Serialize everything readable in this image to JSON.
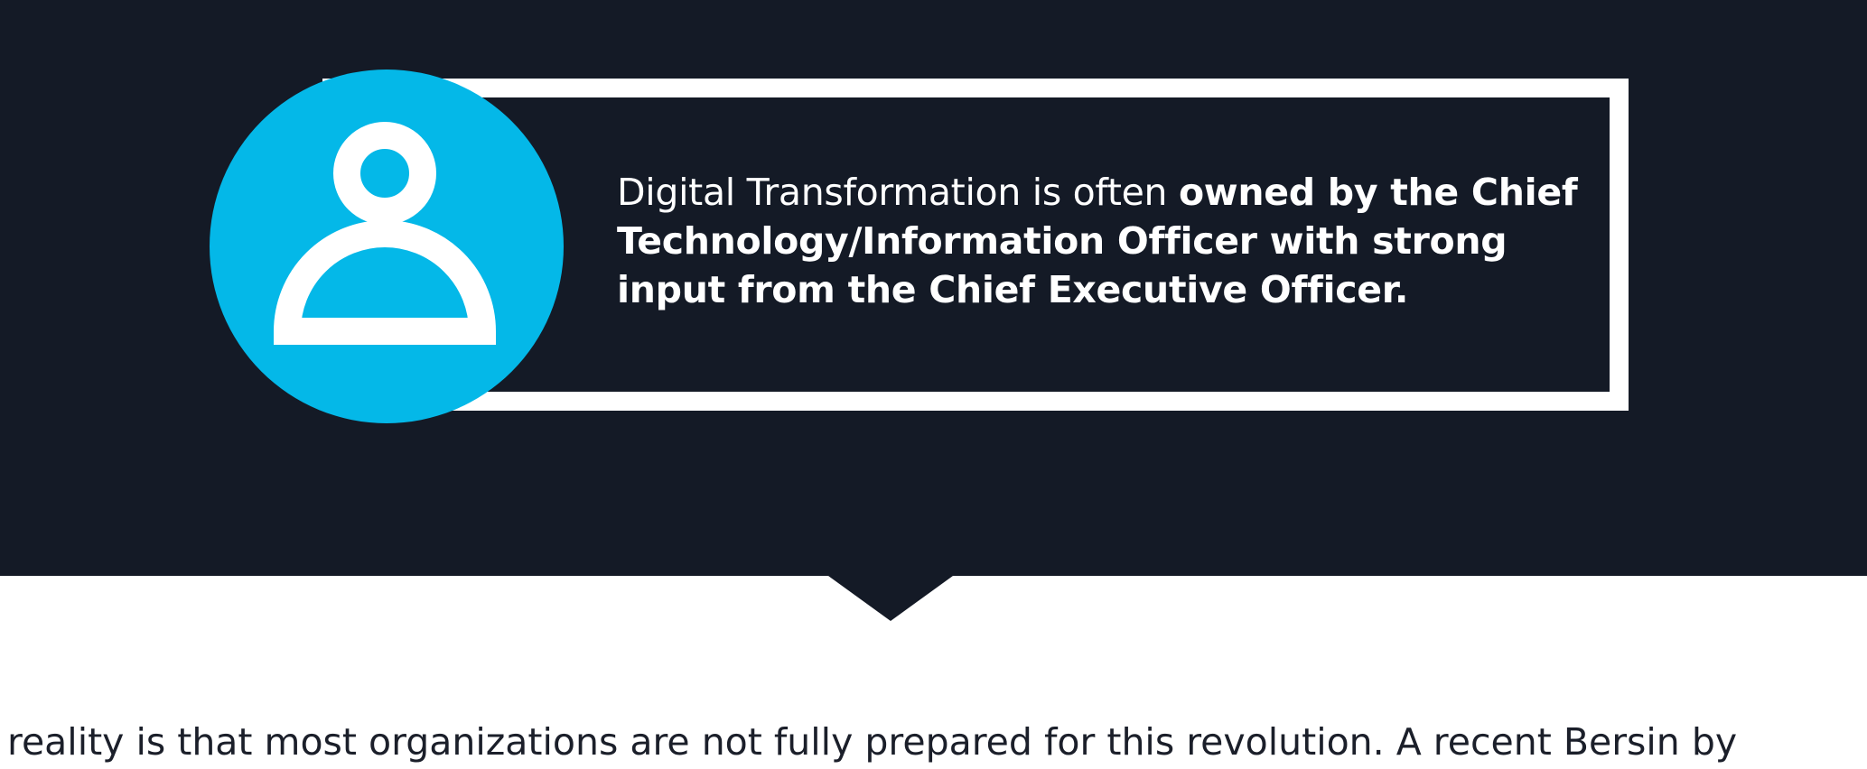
{
  "callout": {
    "lead_text": "Digital Transformation is often ",
    "emphasis_text": "owned by the Chief Technology/Information Officer with strong input from the Chief Executive Officer."
  },
  "body": {
    "paragraph_fragment": "reality is that most organizations are not fully prepared for this revolution. A recent Bersin by"
  },
  "icons": {
    "avatar": "user-icon"
  },
  "colors": {
    "hero_background": "#141a26",
    "accent": "#04b8e8",
    "callout_border": "#ffffff",
    "body_text": "#1b1f2a"
  }
}
